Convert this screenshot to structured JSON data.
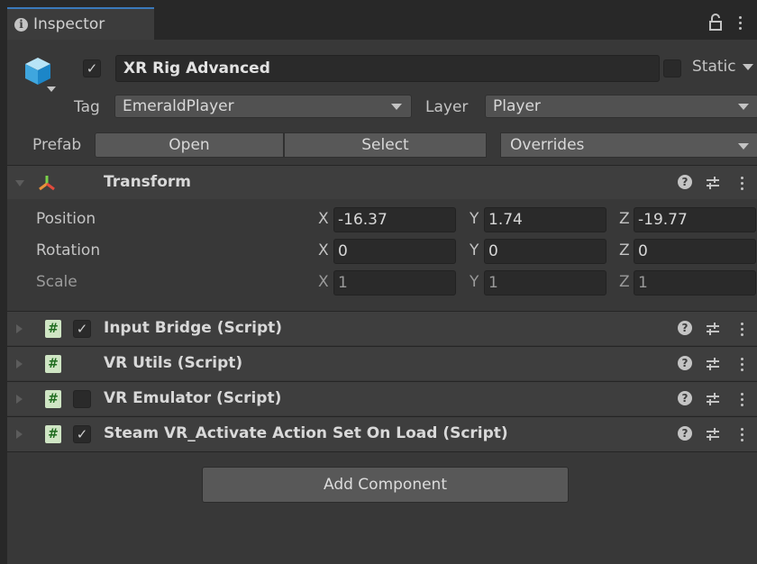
{
  "tab": {
    "label": "Inspector"
  },
  "header": {
    "name": "XR Rig Advanced",
    "active_check": "✓",
    "static_label": "Static",
    "tag_label": "Tag",
    "tag_value": "EmeraldPlayer",
    "layer_label": "Layer",
    "layer_value": "Player",
    "prefab_label": "Prefab",
    "prefab_open": "Open",
    "prefab_select": "Select",
    "prefab_overrides": "Overrides"
  },
  "transform": {
    "title": "Transform",
    "rows": [
      {
        "label": "Position",
        "x": "-16.37",
        "y": "1.74",
        "z": "-19.77"
      },
      {
        "label": "Rotation",
        "x": "0",
        "y": "0",
        "z": "0"
      },
      {
        "label": "Scale",
        "x": "1",
        "y": "1",
        "z": "1"
      }
    ],
    "axes": {
      "x": "X",
      "y": "Y",
      "z": "Z"
    }
  },
  "components": [
    {
      "title": "Input Bridge (Script)",
      "checked": true,
      "check": "✓"
    },
    {
      "title": "VR Utils (Script)",
      "checked": null,
      "check": ""
    },
    {
      "title": "VR Emulator (Script)",
      "checked": false,
      "check": ""
    },
    {
      "title": "Steam VR_Activate Action Set On Load (Script)",
      "checked": true,
      "check": "✓"
    }
  ],
  "icons": {
    "help": "?",
    "hash": "#",
    "lock": "a"
  },
  "add_component": "Add Component",
  "colors": {
    "accent": "#3a79bb",
    "script_icon": "#cfe5c4",
    "panel": "#383838"
  }
}
